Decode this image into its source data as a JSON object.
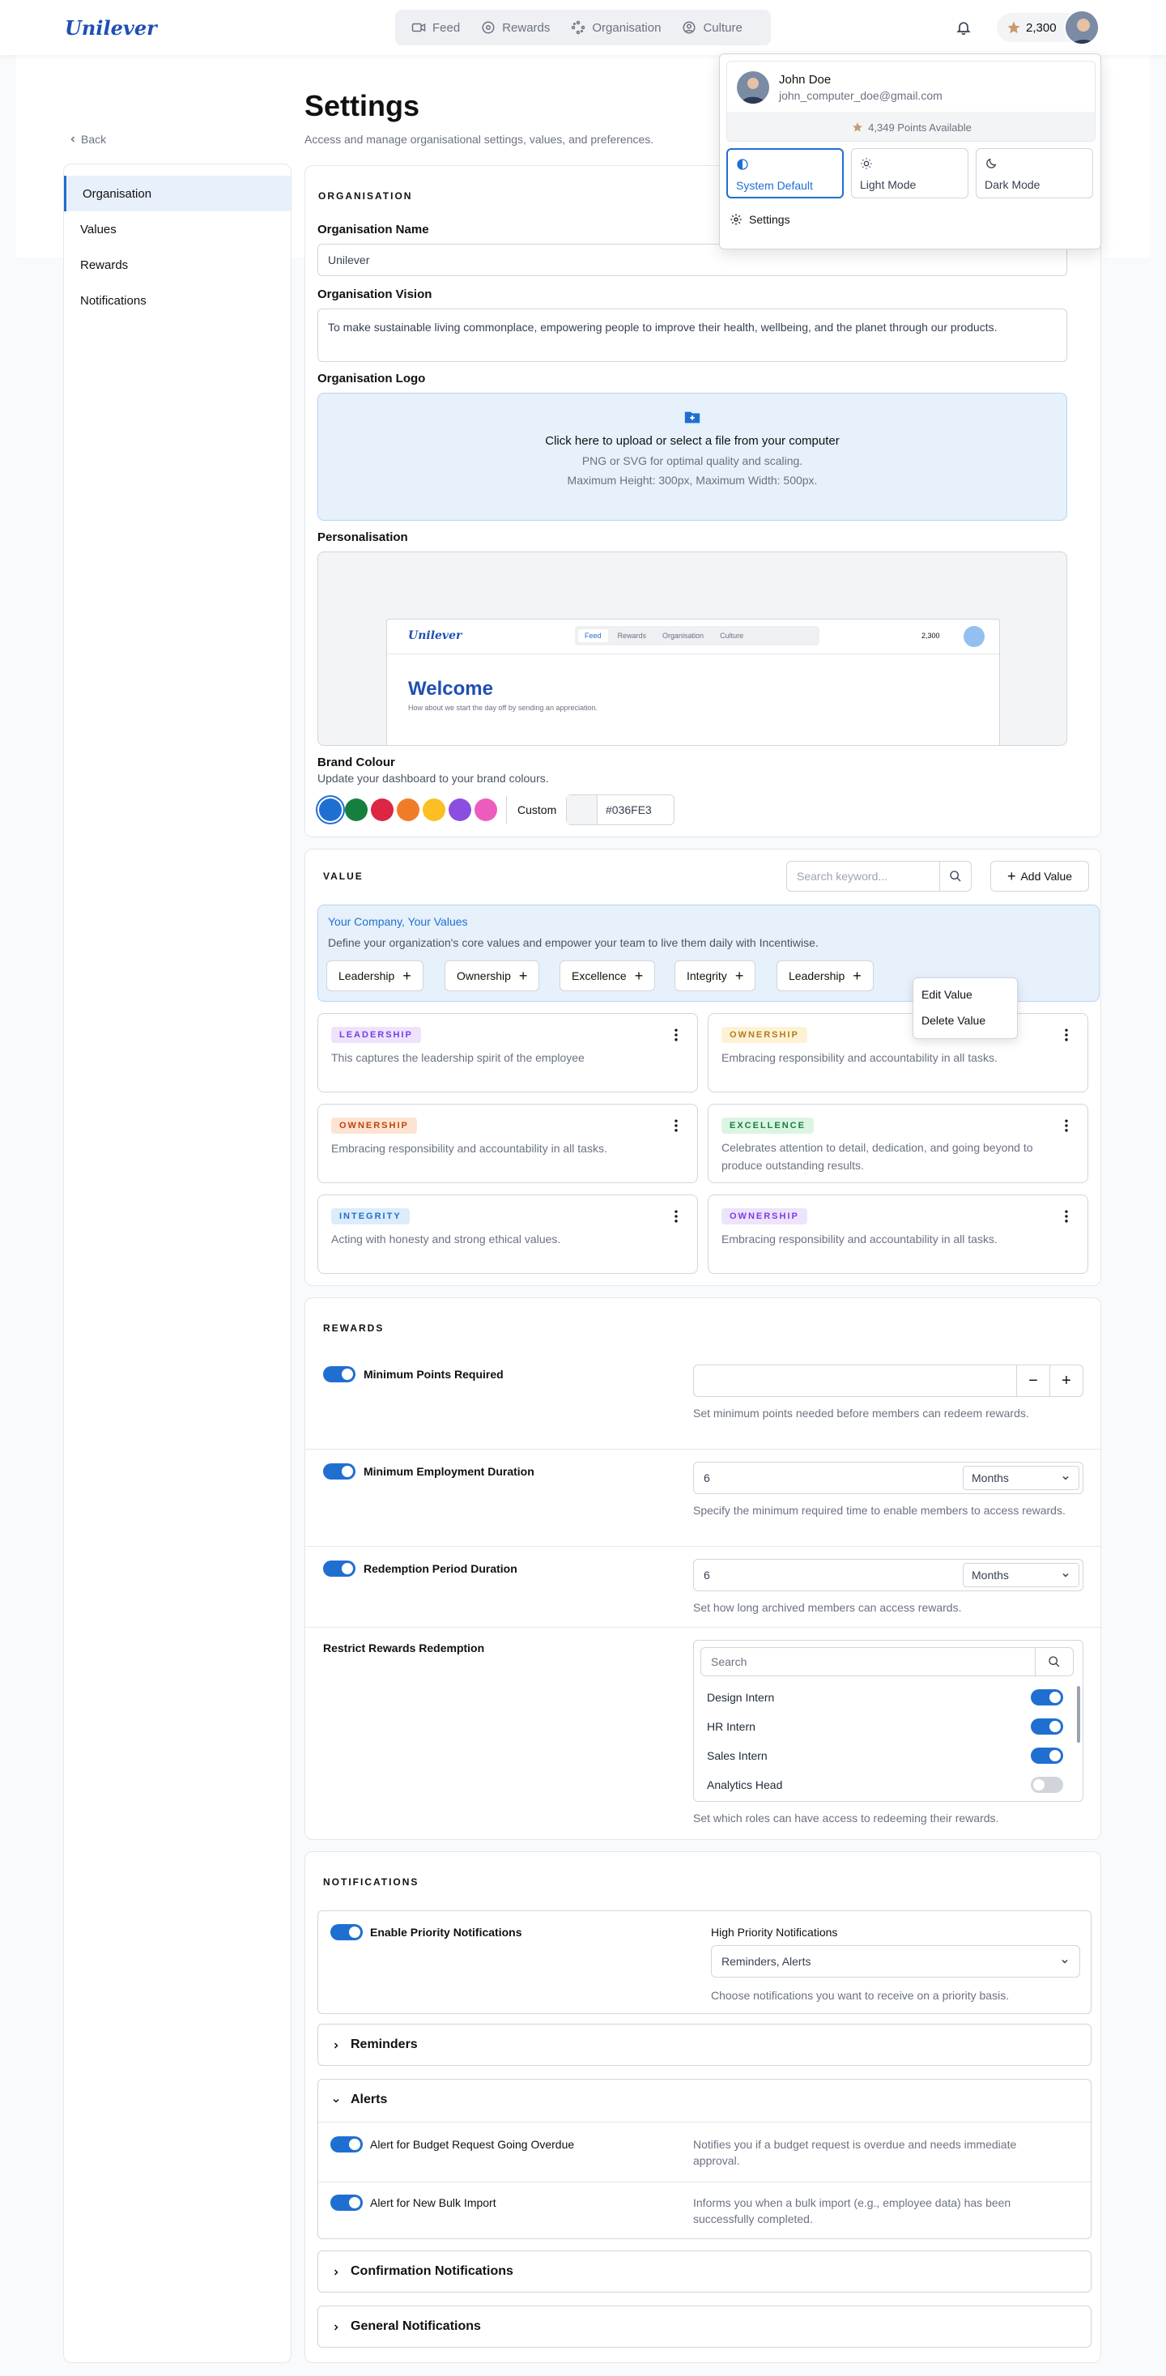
{
  "brand": {
    "name": "Unilever",
    "accent": "#1f6fd1"
  },
  "nav": {
    "items": [
      {
        "label": "Feed",
        "icon": "camera-icon"
      },
      {
        "label": "Rewards",
        "icon": "rewards-icon"
      },
      {
        "label": "Organisation",
        "icon": "organisation-icon"
      },
      {
        "label": "Culture",
        "icon": "culture-icon"
      }
    ],
    "points": "2,300"
  },
  "user_menu": {
    "name": "John Doe",
    "email": "john_computer_doe@gmail.com",
    "points_available": "4,349 Points Available",
    "modes": [
      "System Default",
      "Light Mode",
      "Dark Mode"
    ],
    "selected_mode": "System Default",
    "settings_label": "Settings"
  },
  "page": {
    "title": "Settings",
    "subtitle": "Access and manage organisational settings, values, and preferences.",
    "back_label": "Back"
  },
  "sidebar": {
    "items": [
      {
        "label": "Organisation"
      },
      {
        "label": "Values"
      },
      {
        "label": "Rewards"
      },
      {
        "label": "Notifications"
      }
    ]
  },
  "organisation": {
    "section_title": "ORGANISATION",
    "name_label": "Organisation Name",
    "name_value": "Unilever",
    "vision_label": "Organisation Vision",
    "vision_value": "To make sustainable living commonplace, empowering people to improve their health, wellbeing, and the planet through our products.",
    "logo_label": "Organisation Logo",
    "upload_title": "Click here to upload or select a file from your computer",
    "upload_hint1": "PNG or SVG for optimal quality and scaling.",
    "upload_hint2": "Maximum Height: 300px, Maximum Width: 500px.",
    "personalisation_label": "Personalisation",
    "preview": {
      "logo": "Unilever",
      "nav": [
        "Feed",
        "Rewards",
        "Organisation",
        "Culture"
      ],
      "points": "2,300",
      "welcome": "Welcome",
      "welcome_sub": "How about we start the day off by sending an appreciation."
    },
    "brand_colour_label": "Brand Colour",
    "brand_colour_sub": "Update your dashboard to your brand colours.",
    "swatches": [
      "#1f6fd1",
      "#15803d",
      "#dc2643",
      "#f07c2a",
      "#fbbf24",
      "#8b4fe0",
      "#ec5cbd"
    ],
    "custom_label": "Custom",
    "custom_hex": "#036FE3"
  },
  "values": {
    "section_title": "VALUE",
    "search_placeholder": "Search keyword...",
    "add_label": "Add Value",
    "info_title": "Your Company, Your Values",
    "info_desc": "Define your organization's core values and empower your team to live them daily with Incentiwise.",
    "chips": [
      "Leadership",
      "Ownership",
      "Excellence",
      "Integrity",
      "Leadership"
    ],
    "cards": [
      {
        "tag": "LEADERSHIP",
        "desc": "This captures the leadership spirit of the employee",
        "bg": "#ede4fb",
        "fg": "#7c3aed"
      },
      {
        "tag": "OWNERSHIP",
        "desc": "Embracing responsibility and accountability in all tasks.",
        "bg": "#fdf3d4",
        "fg": "#b7791f"
      },
      {
        "tag": "OWNERSHIP",
        "desc": "Embracing responsibility and accountability in all tasks.",
        "bg": "#fde4d2",
        "fg": "#c2410c"
      },
      {
        "tag": "EXCELLENCE",
        "desc": "Celebrates attention to detail, dedication, and going beyond to produce outstanding results.",
        "bg": "#dcf5e2",
        "fg": "#15803d"
      },
      {
        "tag": "INTEGRITY",
        "desc": "Acting with honesty and strong ethical values.",
        "bg": "#dcecfb",
        "fg": "#1f6fd1"
      },
      {
        "tag": "OWNERSHIP",
        "desc": "Embracing responsibility and accountability in all tasks.",
        "bg": "#ede4fb",
        "fg": "#7c3aed"
      }
    ],
    "context_menu": [
      "Edit Value",
      "Delete Value"
    ]
  },
  "rewards": {
    "section_title": "REWARDS",
    "min_points_label": "Minimum Points Required",
    "min_points_value": "",
    "min_points_hint": "Set minimum points needed before members can redeem rewards.",
    "min_emp_label": "Minimum Employment Duration",
    "min_emp_value": "6",
    "min_emp_unit": "Months",
    "min_emp_hint": "Specify the minimum required time to enable members to access rewards.",
    "redeem_label": "Redemption Period Duration",
    "redeem_value": "6",
    "redeem_unit": "Months",
    "redeem_hint": "Set how long archived members can access rewards.",
    "restrict_label": "Restrict Rewards Redemption",
    "search_placeholder": "Search",
    "roles": [
      {
        "name": "Design Intern",
        "on": true
      },
      {
        "name": "HR Intern",
        "on": true
      },
      {
        "name": "Sales Intern",
        "on": true
      },
      {
        "name": "Analytics Head",
        "on": false
      }
    ],
    "restrict_hint": "Set which roles can have access to redeeming their rewards."
  },
  "notifications": {
    "section_title": "NOTIFICATIONS",
    "priority_label": "Enable Priority Notifications",
    "high_label": "High Priority Notifications",
    "high_value": "Reminders, Alerts",
    "high_hint": "Choose notifications you want to receive on a priority basis.",
    "reminders": "Reminders",
    "alerts": "Alerts",
    "alert_items": [
      {
        "label": "Alert for Budget Request Going Overdue",
        "hint": "Notifies you if a budget request is overdue and needs immediate approval."
      },
      {
        "label": "Alert for New Bulk Import",
        "hint": "Informs you when a bulk import (e.g., employee data) has been successfully completed."
      }
    ],
    "confirmation": "Confirmation Notifications",
    "general": "General Notifications"
  }
}
